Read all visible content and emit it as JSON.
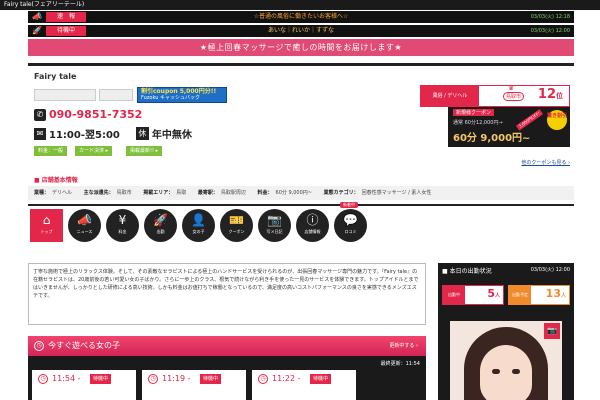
{
  "top_strip": {
    "label": "Fairy tale(フェアリーテール)"
  },
  "ticker": [
    {
      "icon": "megaphone-icon",
      "tag": "速　報",
      "message": "☆普通の風俗に働きたいお客様へ☆",
      "time": "03/03(火) 12:18"
    },
    {
      "icon": "rocket-icon",
      "tag": "待機中",
      "message": "あいな｜れいか｜すずな",
      "time": "03/03(火) 12:00"
    }
  ],
  "banner": "★極上回春マッサージで癒しの時間をお届けします★",
  "shop": {
    "name": "Fairy tale",
    "coupon_banner": {
      "line1": "割引coupon 5,000円分!!",
      "line2": "Fuzoku キャッシュバック"
    },
    "phone": "090-9851-7352",
    "hours": "11:00-翌5:00",
    "holiday_icon": "休",
    "holiday": "年中無休",
    "buttons": [
      "料金：一般",
      "カード決済 ▸",
      "掲載最新!! ▸"
    ]
  },
  "rank": {
    "label": "風俗 / デリヘル",
    "area": "鳥取市",
    "rank_num": "12",
    "rank_unit": "位"
  },
  "coupon": {
    "caption": "新規様クーポン",
    "course": "通常 60分12,000円→",
    "price": "60分 9,000円~",
    "discount": "驚き割引",
    "ribbon": "3,000円OFF!",
    "link": "他のクーポンも見る ›"
  },
  "basic_info": {
    "heading": "店舗基本情報",
    "fields": [
      {
        "label": "業種：",
        "value": "デリヘル"
      },
      {
        "label": "主な派遣先：",
        "value": "鳥取市"
      },
      {
        "label": "掲載エリア：",
        "value": "鳥取"
      },
      {
        "label": "最寄駅：",
        "value": "鳥取駅周辺"
      },
      {
        "label": "料金：",
        "value": "60分 9,000円~"
      },
      {
        "label": "業態カテゴリ：",
        "value": "回春性感マッサージ / 素人女性"
      }
    ]
  },
  "nav": [
    {
      "label": "トップ",
      "glyph": "⌂",
      "icon": "home-icon"
    },
    {
      "label": "ニュース",
      "glyph": "📣",
      "icon": "news-icon"
    },
    {
      "label": "料金",
      "glyph": "¥",
      "icon": "yen-icon"
    },
    {
      "label": "出勤",
      "glyph": "🚀",
      "icon": "rocket-icon"
    },
    {
      "label": "女の子",
      "glyph": "👤",
      "icon": "girl-icon"
    },
    {
      "label": "クーポン",
      "glyph": "🎫",
      "icon": "coupon-icon"
    },
    {
      "label": "写メ日記",
      "glyph": "📷",
      "icon": "camera-icon"
    },
    {
      "label": "店舗情報",
      "glyph": "ⓘ",
      "icon": "info-icon"
    },
    {
      "label": "口コミ",
      "glyph": "💬",
      "icon": "review-icon"
    }
  ],
  "new_tag": "新着中",
  "description": "丁寧な施術で極上のリラックス体験。そして、その素敵なセラピストによる極上のハンドサービスを受けられるのが、出張回春マッサージ専門の魅力です。『Fairy tale』の在籍セラピストは、20歳前後の若い可愛い女の子ばかり。さらに一歩上のクラス、根気で続けながら利き手を使った一見のサービスを体験できます。トップアイドルとまではいきませんが、しっかりとした研修による高い技術。しかも料金はお値打ちで稼働となっているので、満足度の高いコストパフォーマンスの良さを実感できるメンズエステです。",
  "now_panel": {
    "title": "今すぐ遊べる女の子",
    "more": "更新中する ›",
    "updated": "最終更新：11:54",
    "cards": [
      {
        "time": "11:54 -",
        "badge": "待機中"
      },
      {
        "time": "11:19 -",
        "badge": "待機中"
      },
      {
        "time": "11:22 -",
        "badge": "待機中"
      }
    ]
  },
  "today": {
    "title": "本日の出勤状況",
    "date": "03/03(火) 12:00",
    "working_label": "出勤中",
    "working_count": "5",
    "planned_label": "出勤予定",
    "planned_count": "13",
    "unit": "人"
  },
  "colors": {
    "accent": "#e2274a",
    "dark": "#1a1a1a",
    "green": "#7fbf3a"
  }
}
